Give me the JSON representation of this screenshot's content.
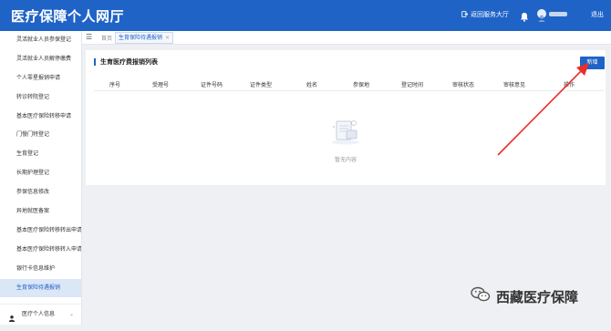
{
  "header": {
    "app_title": "医疗保障个人网厅",
    "return_hall": "返回服务大厅",
    "logout": "退出"
  },
  "sidebar": {
    "items": [
      {
        "label": "灵活就业人员参保登记"
      },
      {
        "label": "灵活就业人员解停缴费"
      },
      {
        "label": "个人零星报销申请"
      },
      {
        "label": "转诊转院登记"
      },
      {
        "label": "基本医疗保险转移申请"
      },
      {
        "label": "门慢门特登记"
      },
      {
        "label": "生育登记"
      },
      {
        "label": "长期护理登记"
      },
      {
        "label": "参保信息修改"
      },
      {
        "label": "异地就医备案"
      },
      {
        "label": "基本医疗保险转移转出申请"
      },
      {
        "label": "基本医疗保险转移转入申请"
      },
      {
        "label": "银行卡信息维护"
      },
      {
        "label": "生育保险待遇报销",
        "active": true
      }
    ],
    "footer_label": "医疗个人信息"
  },
  "tabs": {
    "home": "首页",
    "current": "生育保险待遇报销",
    "close": "×"
  },
  "panel": {
    "title": "生育医疗费报销列表",
    "add_button": "新增",
    "columns": [
      "序号",
      "受理号",
      "证件号码",
      "证件类型",
      "姓名",
      "参保地",
      "登记时间",
      "审核状态",
      "审核意见",
      "操作"
    ],
    "empty_text": "暂无内容"
  },
  "watermark": {
    "text": "西藏医疗保障"
  },
  "colors": {
    "primary": "#1f63c6",
    "annotation_arrow": "#e8302a"
  },
  "icons": {
    "return": "exit-icon",
    "bell": "bell-icon",
    "user": "user-icon",
    "menu_toggle": "menu-toggle-icon",
    "empty": "empty-document-icon",
    "wechat": "wechat-icon"
  }
}
